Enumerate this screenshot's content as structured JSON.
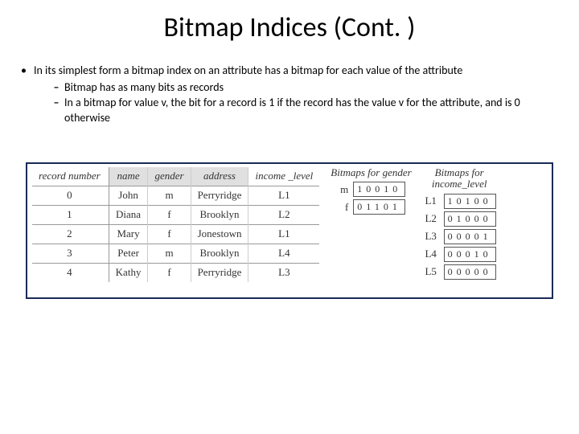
{
  "title": "Bitmap Indices (Cont. )",
  "bullet": {
    "text": "In its simplest form a bitmap index on an attribute has a bitmap for each value of the attribute",
    "subs": [
      "Bitmap has as many bits as records",
      "In a bitmap for value v, the bit for a record is 1 if the record has the value v for the attribute, and is 0 otherwise"
    ]
  },
  "mainTable": {
    "headerRecord": "record\nnumber",
    "headers": [
      "name",
      "gender",
      "address",
      "income\n_level"
    ],
    "rows": [
      [
        "0",
        "John",
        "m",
        "Perryridge",
        "L1"
      ],
      [
        "1",
        "Diana",
        "f",
        "Brooklyn",
        "L2"
      ],
      [
        "2",
        "Mary",
        "f",
        "Jonestown",
        "L1"
      ],
      [
        "3",
        "Peter",
        "m",
        "Brooklyn",
        "L4"
      ],
      [
        "4",
        "Kathy",
        "f",
        "Perryridge",
        "L3"
      ]
    ]
  },
  "bmpGender": {
    "title": "Bitmaps for gender",
    "rows": [
      {
        "label": "m",
        "bits": "10010"
      },
      {
        "label": "f",
        "bits": "01101"
      }
    ]
  },
  "bmpIncome": {
    "title": "Bitmaps for\nincome_level",
    "rows": [
      {
        "label": "L1",
        "bits": "10100"
      },
      {
        "label": "L2",
        "bits": "01000"
      },
      {
        "label": "L3",
        "bits": "00001"
      },
      {
        "label": "L4",
        "bits": "00010"
      },
      {
        "label": "L5",
        "bits": "00000"
      }
    ]
  }
}
